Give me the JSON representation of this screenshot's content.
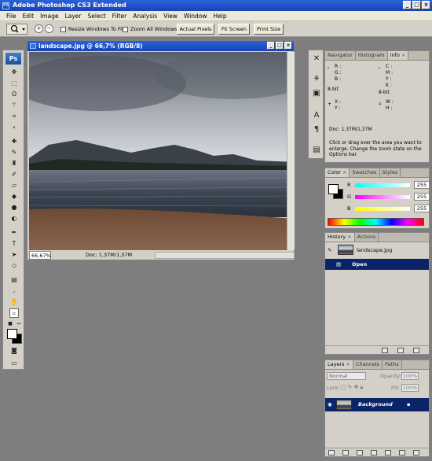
{
  "window": {
    "title": "Adobe Photoshop CS3 Extended",
    "app_icon": "PS"
  },
  "window_controls": {
    "minimize": "_",
    "maximize": "□",
    "close": "×"
  },
  "menu": [
    "File",
    "Edit",
    "Image",
    "Layer",
    "Select",
    "Filter",
    "Analysis",
    "View",
    "Window",
    "Help"
  ],
  "options": {
    "resize_windows": "Resize Windows To Fit",
    "zoom_all": "Zoom All Windows",
    "actual_pixels": "Actual Pixels",
    "fit_screen": "Fit Screen",
    "print_size": "Print Size"
  },
  "toolbox": {
    "logo": "Ps"
  },
  "document": {
    "title": "landscape.jpg @ 66,7% (RGB/8)",
    "zoom": "66,67%",
    "doc_size": "Doc: 1,37M/1,37M"
  },
  "info_panel": {
    "tabs": [
      "Navigator",
      "Histogram",
      "Info"
    ],
    "r": "R :",
    "g": "G :",
    "b": "B :",
    "c": "C :",
    "m": "M :",
    "y": "Y :",
    "k": "K :",
    "bit1": "8-bit",
    "bit2": "8-bit",
    "x": "X :",
    "yy": "Y :",
    "w": "W :",
    "h": "H :",
    "doc": "Doc: 1,37M/1,37M",
    "message": "Click or drag over the area you want to enlarge. Change the zoom state on the Options bar."
  },
  "color_panel": {
    "tabs": [
      "Color",
      "Swatches",
      "Styles"
    ],
    "r_label": "R",
    "g_label": "G",
    "b_label": "B",
    "r_value": "255",
    "g_value": "255",
    "b_value": "255"
  },
  "history_panel": {
    "tabs": [
      "History",
      "Actions"
    ],
    "snapshot": "landscape.jpg",
    "step": "Open"
  },
  "layers_panel": {
    "tabs": [
      "Layers",
      "Channels",
      "Paths"
    ],
    "blend_mode": "Normal",
    "opacity_label": "Opacity:",
    "opacity": "100%",
    "lock_label": "Lock:",
    "fill_label": "Fill:",
    "fill": "100%",
    "layer_name": "Background"
  },
  "colors": {
    "accent": "#0a246a",
    "title_bar": "#1d4fc4"
  }
}
